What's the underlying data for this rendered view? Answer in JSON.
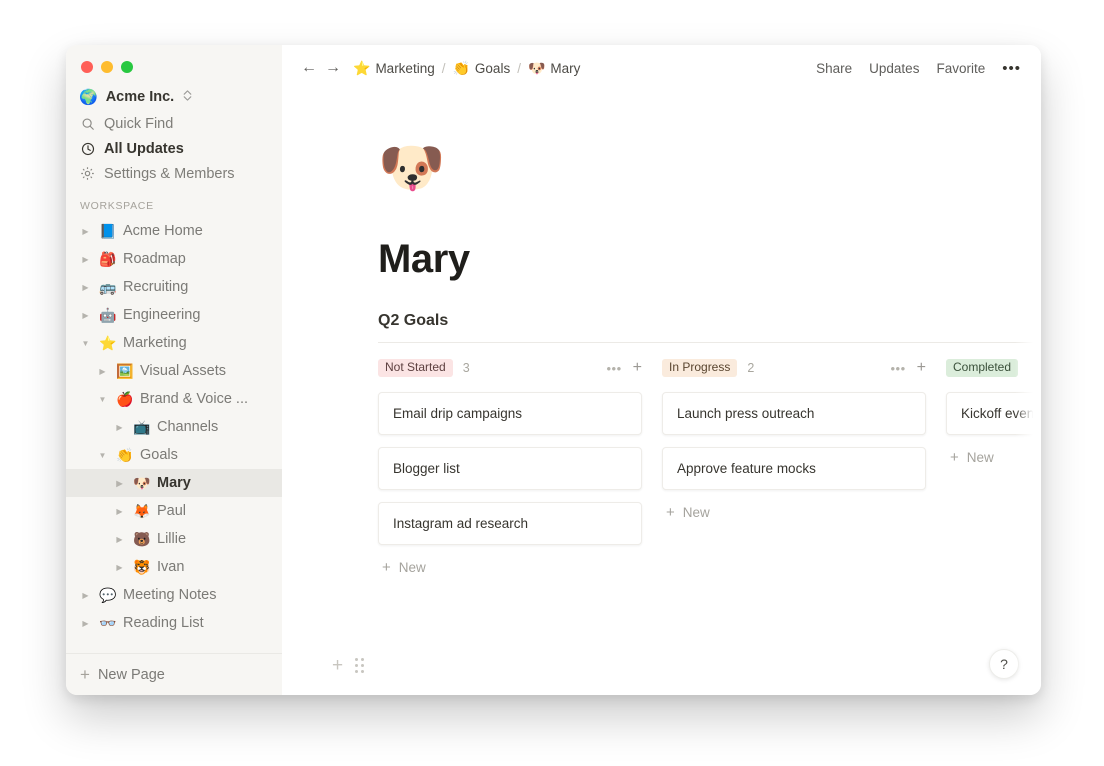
{
  "window": {
    "traffic_lights": [
      {
        "name": "close",
        "color": "#ff5f57"
      },
      {
        "name": "minimize",
        "color": "#febc2e"
      },
      {
        "name": "maximize",
        "color": "#28c840"
      }
    ]
  },
  "sidebar": {
    "workspace": {
      "emoji": "🌍",
      "name": "Acme Inc.",
      "switcher": "⌃⌄"
    },
    "nav": [
      {
        "icon": "search-icon",
        "label": "Quick Find",
        "strong": false
      },
      {
        "icon": "clock-icon",
        "label": "All Updates",
        "strong": true
      },
      {
        "icon": "gear-icon",
        "label": "Settings & Members",
        "strong": false
      }
    ],
    "section_label": "WORKSPACE",
    "tree": [
      {
        "emoji": "📘",
        "label": "Acme Home",
        "depth": 0,
        "expanded": false,
        "selected": false
      },
      {
        "emoji": "🎒",
        "label": "Roadmap",
        "depth": 0,
        "expanded": false,
        "selected": false
      },
      {
        "emoji": "🚌",
        "label": "Recruiting",
        "depth": 0,
        "expanded": false,
        "selected": false
      },
      {
        "emoji": "🤖",
        "label": "Engineering",
        "depth": 0,
        "expanded": false,
        "selected": false
      },
      {
        "emoji": "⭐",
        "label": "Marketing",
        "depth": 0,
        "expanded": true,
        "selected": false
      },
      {
        "emoji": "🖼️",
        "label": "Visual Assets",
        "depth": 1,
        "expanded": false,
        "selected": false
      },
      {
        "emoji": "🍎",
        "label": "Brand & Voice ...",
        "depth": 1,
        "expanded": true,
        "selected": false
      },
      {
        "emoji": "📺",
        "label": "Channels",
        "depth": 2,
        "expanded": false,
        "selected": false
      },
      {
        "emoji": "👏",
        "label": "Goals",
        "depth": 1,
        "expanded": true,
        "selected": false
      },
      {
        "emoji": "🐶",
        "label": "Mary",
        "depth": 2,
        "expanded": false,
        "selected": true
      },
      {
        "emoji": "🦊",
        "label": "Paul",
        "depth": 2,
        "expanded": false,
        "selected": false
      },
      {
        "emoji": "🐻",
        "label": "Lillie",
        "depth": 2,
        "expanded": false,
        "selected": false
      },
      {
        "emoji": "🐯",
        "label": "Ivan",
        "depth": 2,
        "expanded": false,
        "selected": false
      },
      {
        "emoji": "💬",
        "label": "Meeting Notes",
        "depth": 0,
        "expanded": false,
        "selected": false
      },
      {
        "emoji": "👓",
        "label": "Reading List",
        "depth": 0,
        "expanded": false,
        "selected": false
      }
    ],
    "footer": {
      "plus": "+",
      "label": "New Page"
    }
  },
  "topbar": {
    "back": "←",
    "forward": "→",
    "breadcrumbs": [
      {
        "emoji": "⭐",
        "label": "Marketing"
      },
      {
        "emoji": "👏",
        "label": "Goals"
      },
      {
        "emoji": "🐶",
        "label": "Mary"
      }
    ],
    "separator": "/",
    "actions": [
      "Share",
      "Updates",
      "Favorite"
    ],
    "more": "•••"
  },
  "page": {
    "emoji": "🐶",
    "title": "Mary",
    "board_title": "Q2 Goals",
    "add_block": "+",
    "drag_handle": "drag-handle",
    "help": "?"
  },
  "board": {
    "columns": [
      {
        "status": "Not Started",
        "badge_bg": "#fbe4e4",
        "badge_fg": "#5d4040",
        "count": "3",
        "menu": "•••",
        "add": "+",
        "cards": [
          "Email drip campaigns",
          "Blogger list",
          "Instagram ad research"
        ],
        "new_label": "New"
      },
      {
        "status": "In Progress",
        "badge_bg": "#faebdd",
        "badge_fg": "#59452f",
        "count": "2",
        "menu": "•••",
        "add": "+",
        "cards": [
          "Launch press outreach",
          "Approve feature mocks"
        ],
        "new_label": "New"
      },
      {
        "status": "Completed",
        "badge_bg": "#dbeddb",
        "badge_fg": "#3a503a",
        "count": "",
        "menu": "•••",
        "add": "+",
        "cards": [
          "Kickoff event"
        ],
        "new_label": "New"
      }
    ]
  }
}
